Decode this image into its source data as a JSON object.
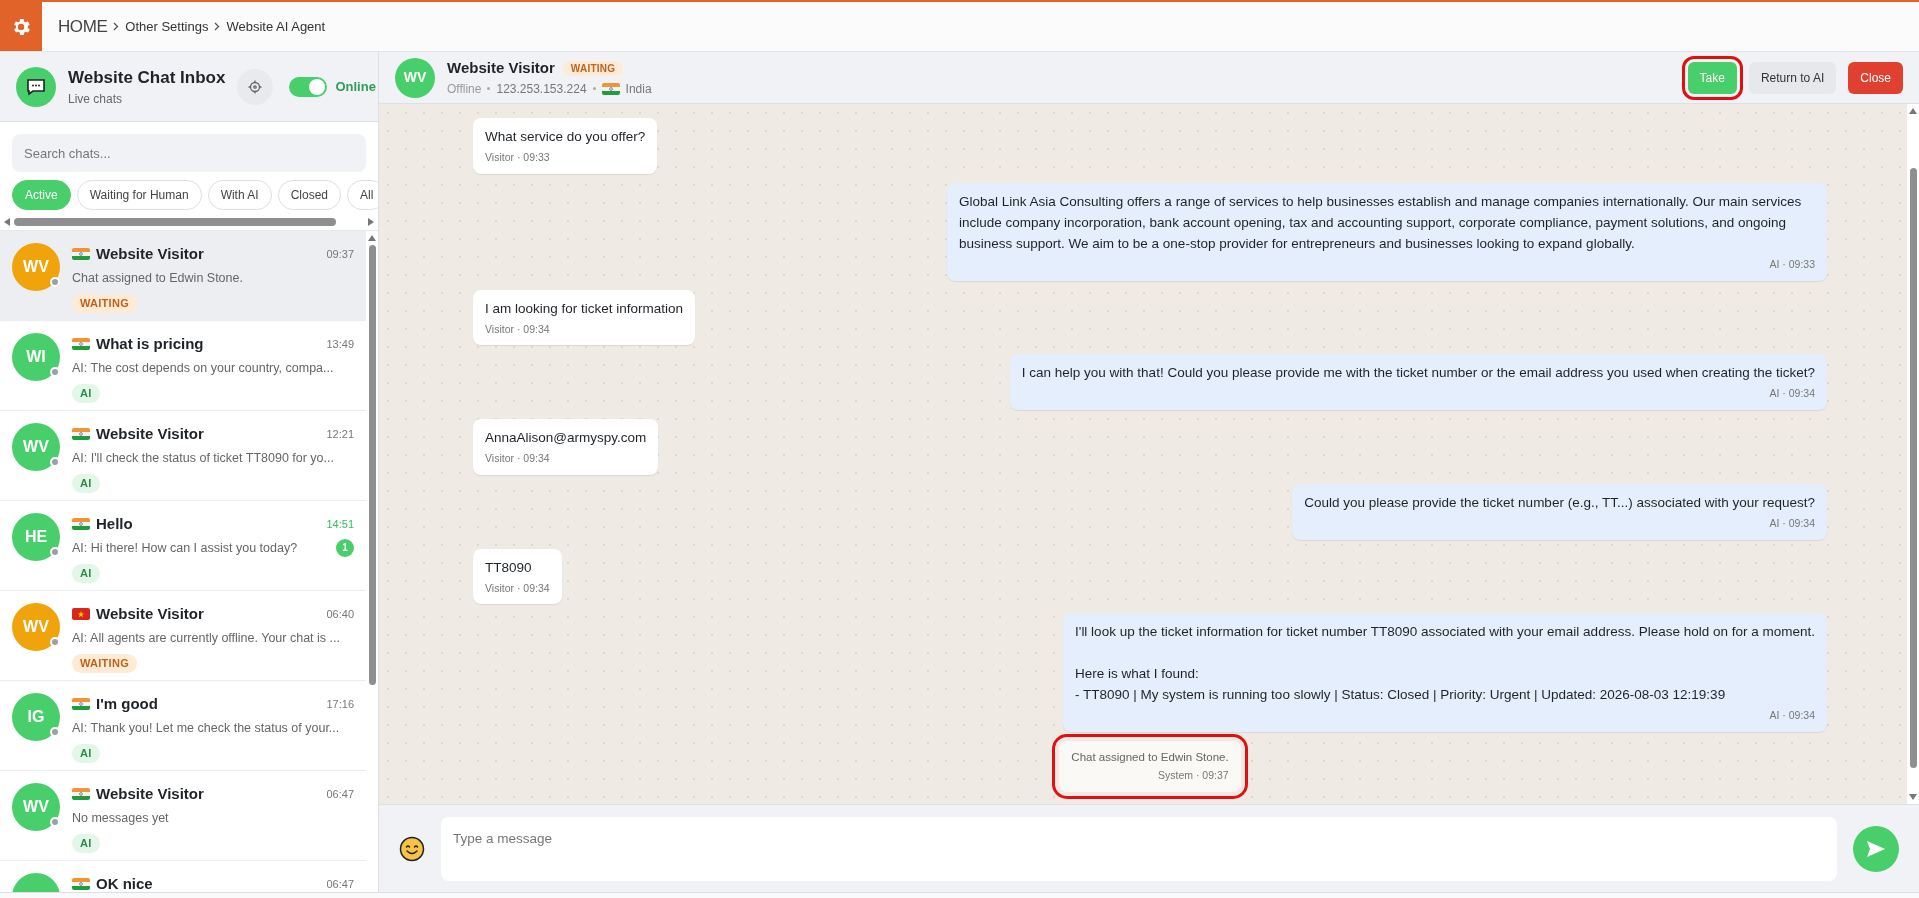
{
  "breadcrumb": {
    "home": "HOME",
    "items": [
      "Other Settings",
      "Website AI Agent"
    ]
  },
  "inbox": {
    "title": "Website Chat Inbox",
    "subtitle": "Live chats",
    "online_toggle": {
      "on": true,
      "label": "Online"
    },
    "search": {
      "placeholder": "Search chats..."
    },
    "filters": [
      {
        "label": "Active",
        "selected": true
      },
      {
        "label": "Waiting for Human",
        "selected": false
      },
      {
        "label": "With AI",
        "selected": false
      },
      {
        "label": "Closed",
        "selected": false
      },
      {
        "label": "All",
        "selected": false
      }
    ],
    "chats": [
      {
        "initials": "WV",
        "color": "#f0a30a",
        "online": false,
        "flag": {
          "kind": "in"
        },
        "name": "Website Visitor",
        "time": "09:37",
        "preview": "Chat assigned to Edwin Stone.",
        "tag": {
          "kind": "waiting",
          "label": "WAITING"
        },
        "selected": true
      },
      {
        "initials": "WI",
        "color": "#48cf6b",
        "online": false,
        "flag": {
          "kind": "in"
        },
        "name": "What is pricing",
        "time": "13:49",
        "preview": "AI: The cost depends on your country, compa...",
        "tag": {
          "kind": "ai",
          "label": "AI"
        },
        "selected": false
      },
      {
        "initials": "WV",
        "color": "#48cf6b",
        "online": false,
        "flag": {
          "kind": "in"
        },
        "name": "Website Visitor",
        "time": "12:21",
        "preview": "AI: I'll check the status of ticket TT8090 for yo...",
        "tag": {
          "kind": "ai",
          "label": "AI"
        },
        "selected": false
      },
      {
        "initials": "HE",
        "color": "#48cf6b",
        "online": false,
        "flag": {
          "kind": "in"
        },
        "name": "Hello",
        "time": "14:51",
        "unread": "1",
        "preview": "AI: Hi there! How can I assist you today?",
        "tag": {
          "kind": "ai",
          "label": "AI"
        },
        "selected": false
      },
      {
        "initials": "WV",
        "color": "#f0a30a",
        "online": false,
        "flag": {
          "kind": "vn"
        },
        "name": "Website Visitor",
        "time": "06:40",
        "preview": "AI: All agents are currently offline. Your chat is ...",
        "tag": {
          "kind": "waiting",
          "label": "WAITING"
        },
        "selected": false
      },
      {
        "initials": "IG",
        "color": "#48cf6b",
        "online": false,
        "flag": {
          "kind": "in"
        },
        "name": "I'm good",
        "time": "17:16",
        "preview": "AI: Thank you! Let me check the status of your...",
        "tag": {
          "kind": "ai",
          "label": "AI"
        },
        "selected": false
      },
      {
        "initials": "WV",
        "color": "#48cf6b",
        "online": false,
        "flag": {
          "kind": "in"
        },
        "name": "Website Visitor",
        "time": "06:47",
        "preview": "No messages yet",
        "tag": {
          "kind": "ai",
          "label": "AI"
        },
        "selected": false
      },
      {
        "color": "#48cf6b",
        "flag": {
          "kind": "in"
        },
        "name": "OK nice",
        "time": "06:47",
        "selected": false
      }
    ]
  },
  "conversation": {
    "initials": "WV",
    "name": "Website Visitor",
    "status_badge": "WAITING",
    "presence": "Offline",
    "ip": "123.253.153.224",
    "flag": {
      "kind": "in"
    },
    "country": "India",
    "actions": [
      {
        "kind": "take",
        "label": "Take",
        "highlighted": true
      },
      {
        "kind": "return",
        "label": "Return to AI",
        "highlighted": false
      },
      {
        "kind": "close",
        "label": "Close",
        "highlighted": false
      }
    ],
    "messages": [
      {
        "kind": "visitor",
        "text": "What service do you offer?",
        "meta": "Visitor · 09:33",
        "highlighted": false
      },
      {
        "kind": "ai",
        "text": "Global Link Asia Consulting offers a range of services to help businesses establish and manage companies internationally. Our main services include company incorporation, bank account opening, tax and accounting support, corporate compliance, payment solutions, and ongoing business support. We aim to be a one-stop provider for entrepreneurs and businesses looking to expand globally.",
        "meta": "AI · 09:33",
        "highlighted": false
      },
      {
        "kind": "visitor",
        "text": "I am looking for ticket information",
        "meta": "Visitor · 09:34",
        "highlighted": false
      },
      {
        "kind": "ai",
        "text": "I can help you with that! Could you please provide me with the ticket number or the email address you used when creating the ticket?",
        "meta": "AI · 09:34",
        "highlighted": false
      },
      {
        "kind": "visitor",
        "text": "AnnaAlison@armyspy.com",
        "meta": "Visitor · 09:34",
        "highlighted": false
      },
      {
        "kind": "ai",
        "text": "Could you please provide the ticket number (e.g., TT...) associated with your request?",
        "meta": "AI · 09:34",
        "highlighted": false
      },
      {
        "kind": "visitor",
        "text": "TT8090",
        "meta": "Visitor · 09:34",
        "highlighted": false
      },
      {
        "kind": "ai",
        "text": "I'll look up the ticket information for ticket number TT8090 associated with your email address. Please hold on for a moment.\n\nHere is what I found:\n- TT8090 | My system is running too slowly | Status: Closed | Priority: Urgent | Updated: 2026-08-03 12:19:39",
        "meta": "AI · 09:34",
        "highlighted": false
      },
      {
        "kind": "system",
        "text": "Chat assigned to Edwin Stone.",
        "meta": "System · 09:37",
        "highlighted": true
      }
    ],
    "composer": {
      "placeholder": "Type a message"
    }
  }
}
